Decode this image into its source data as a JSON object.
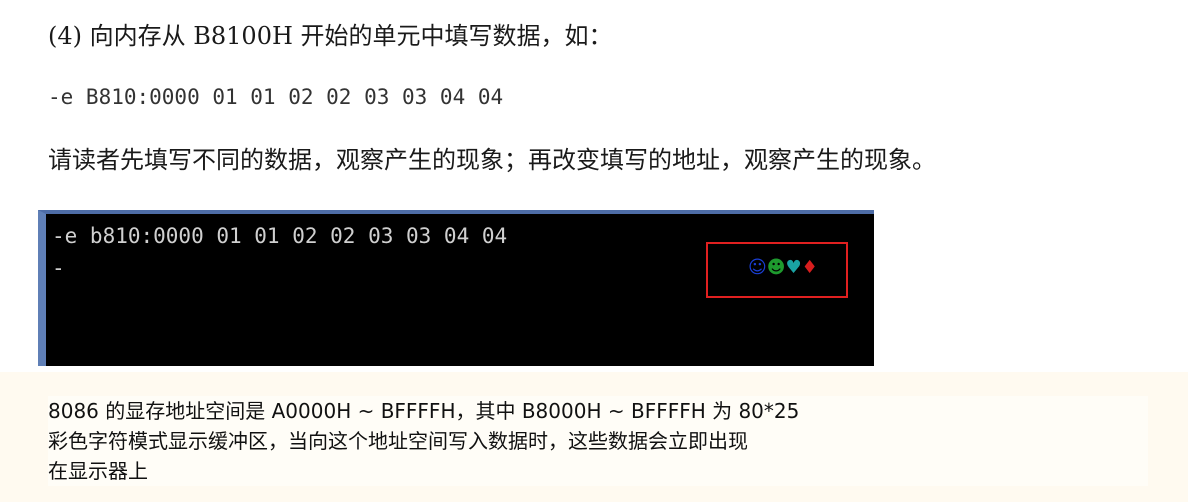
{
  "heading": "(4) 向内存从 B8100H 开始的单元中填写数据，如：",
  "command": "-e B810:0000 01 01 02 02 03 03 04 04",
  "instruction": "请读者先填写不同的数据，观察产生的现象；再改变填写的地址，观察产生的现象。",
  "console": {
    "line1": "-e b810:0000 01 01 02 02 03 03 04 04",
    "line2": "-",
    "glyphs": [
      {
        "char": "☺",
        "color": "#1a3fd6"
      },
      {
        "char": "☻",
        "color": "#1e9a2e"
      },
      {
        "char": "♥",
        "color": "#1aa3a3"
      },
      {
        "char": "♦",
        "color": "#d81e1e"
      }
    ]
  },
  "note": {
    "line1": "8086 的显存地址空间是 A0000H ~ BFFFFH，其中 B8000H ~ BFFFFH 为 80*25",
    "line2": "彩色字符模式显示缓冲区，当向这个地址空间写入数据时，这些数据会立即出现",
    "line3": "在显示器上"
  }
}
